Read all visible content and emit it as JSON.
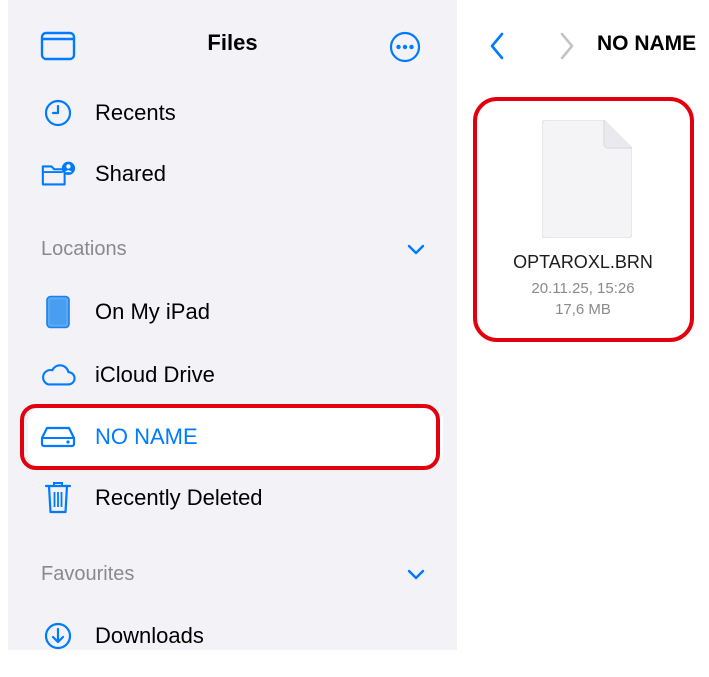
{
  "sidebar": {
    "title": "Files",
    "items_top": [
      {
        "label": "Recents",
        "icon": "clock-icon"
      },
      {
        "label": "Shared",
        "icon": "shared-folder-icon"
      }
    ],
    "locations": {
      "heading": "Locations",
      "items": [
        {
          "label": "On My iPad",
          "icon": "ipad-icon"
        },
        {
          "label": "iCloud Drive",
          "icon": "cloud-icon"
        },
        {
          "label": "NO NAME",
          "icon": "drive-icon",
          "selected": true
        },
        {
          "label": "Recently Deleted",
          "icon": "trash-icon"
        }
      ]
    },
    "favourites": {
      "heading": "Favourites",
      "items": [
        {
          "label": "Downloads",
          "icon": "download-icon"
        }
      ]
    }
  },
  "main": {
    "folder_title": "NO NAME",
    "file": {
      "name": "OPTAROXL.BRN",
      "date": "20.11.25, 15:26",
      "size": "17,6 MB"
    }
  },
  "colors": {
    "accent": "#007aff",
    "highlight": "#e2000f",
    "sidebar_bg": "#f2f2f7",
    "secondary_text": "#8a8a8e"
  }
}
